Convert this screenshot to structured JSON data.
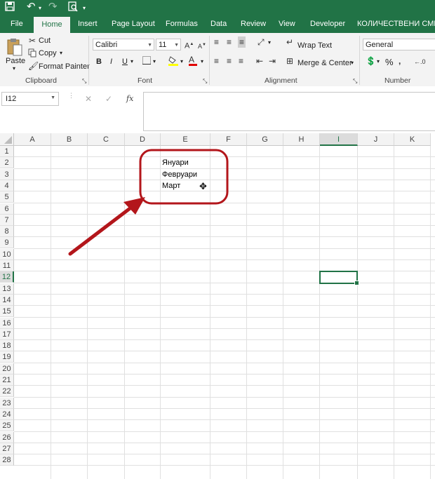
{
  "quick_access": {
    "save_icon": "save-icon",
    "undo_icon": "undo-icon",
    "redo_icon": "redo-icon",
    "print_preview_icon": "print-preview-icon"
  },
  "tabs": [
    "File",
    "Home",
    "Insert",
    "Page Layout",
    "Formulas",
    "Data",
    "Review",
    "View",
    "Developer",
    "КОЛИЧЕСТВЕНИ СМЕТКИ"
  ],
  "active_tab": "Home",
  "clipboard": {
    "paste": "Paste",
    "cut": "Cut",
    "copy": "Copy",
    "format_painter": "Format Painter",
    "group": "Clipboard"
  },
  "font": {
    "name": "Calibri",
    "size": "11",
    "bold": "B",
    "italic": "I",
    "underline": "U",
    "font_color_glyph": "A",
    "group": "Font"
  },
  "alignment": {
    "wrap_text": "Wrap Text",
    "merge_center": "Merge & Center",
    "group": "Alignment"
  },
  "number": {
    "format": "General",
    "percent": "%",
    "group": "Number"
  },
  "formula_bar": {
    "name_box": "I12",
    "fx": "fx",
    "cancel": "✕",
    "enter": "✓",
    "value": ""
  },
  "columns": [
    "A",
    "B",
    "C",
    "D",
    "E",
    "F",
    "G",
    "H",
    "I",
    "J",
    "K"
  ],
  "rows": [
    "1",
    "2",
    "3",
    "4",
    "5",
    "6",
    "7",
    "8",
    "9",
    "10",
    "11",
    "12",
    "13",
    "14",
    "15",
    "16",
    "17",
    "18",
    "19",
    "20",
    "21",
    "22",
    "23",
    "24",
    "25",
    "26",
    "27",
    "28"
  ],
  "selected_cell": "I12",
  "cells": [
    {
      "ref": "E2",
      "value": "Януари"
    },
    {
      "ref": "E3",
      "value": "Февруари"
    },
    {
      "ref": "E4",
      "value": "Март"
    }
  ],
  "colors": {
    "excel_green": "#217346",
    "annotation_red": "#b3161b",
    "selection_green": "#217346"
  }
}
